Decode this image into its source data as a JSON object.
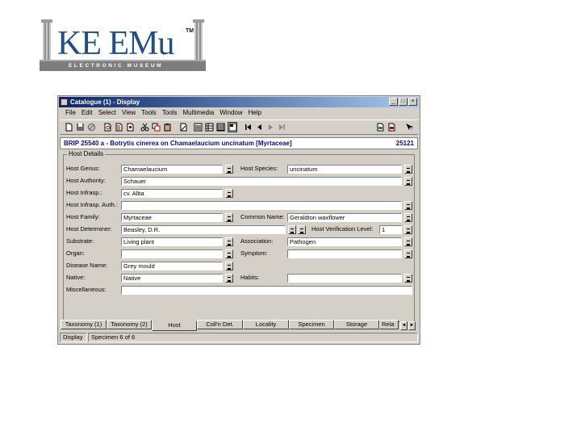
{
  "logo": {
    "main": "KE EMu",
    "tm": "TM",
    "sub": "ELECTRONIC MUSEUM"
  },
  "window": {
    "title": "Catalogue (1) - Display",
    "buttons": {
      "minimize": "_",
      "maximize": "□",
      "close": "×"
    },
    "menu": [
      "File",
      "Edit",
      "Select",
      "View",
      "Tools",
      "Tools",
      "Multimedia",
      "Window",
      "Help"
    ],
    "record_title": "BRIP 25540 a - Botrytis cinerea on Chamaelaucium uncinatum [Myrtaceae]",
    "record_number": "25121",
    "group_title": "Host Details",
    "fields": {
      "host_genus": {
        "label": "Host Genus:",
        "value": "Chamaelaucium"
      },
      "host_species": {
        "label": "Host Species:",
        "value": "uncinatum"
      },
      "host_authority": {
        "label": "Host Authority:",
        "value": "Schauer"
      },
      "host_infrasp": {
        "label": "Host Infrasp.:",
        "value": "cv. Alba"
      },
      "host_infrasp_auth": {
        "label": "Host Infrasp. Auth.:",
        "value": ""
      },
      "host_family": {
        "label": "Host Family:",
        "value": "Myrtaceae"
      },
      "common_name": {
        "label": "Common Name:",
        "value": "Geraldton waxflower"
      },
      "host_determiner": {
        "label": "Host Determiner:",
        "value": "Beasley, D.R."
      },
      "host_verification_level": {
        "label": "Host Verification Level:",
        "value": "1"
      },
      "substrate": {
        "label": "Substrate:",
        "value": "Living plant"
      },
      "association": {
        "label": "Association:",
        "value": "Pathogen"
      },
      "organ": {
        "label": "Organ:",
        "value": ""
      },
      "symptom": {
        "label": "Symptom:",
        "value": ""
      },
      "disease_name": {
        "label": "Disease Name:",
        "value": "Grey mould"
      },
      "native": {
        "label": "Native:",
        "value": "Native"
      },
      "habit": {
        "label": "Habits:",
        "value": ""
      },
      "miscellaneous": {
        "label": "Miscellaneous:",
        "value": ""
      }
    },
    "tabs": [
      "Taxonomy (1)",
      "Taxonomy (2)",
      "Host",
      "Coll'n Det.",
      "Locality",
      "Specimen",
      "Storage",
      "Rela"
    ],
    "tab_scroll": {
      "left": "◄",
      "right": "►"
    },
    "status": {
      "mode": "Display",
      "record": "Specimen 6 of 6"
    }
  }
}
